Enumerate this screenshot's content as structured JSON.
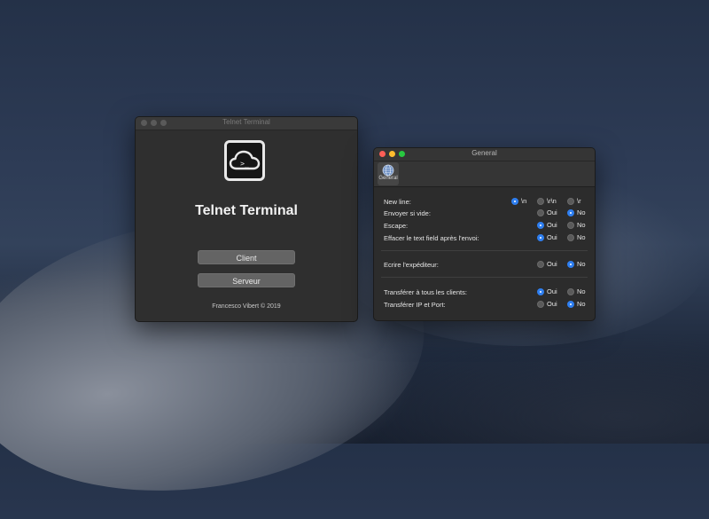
{
  "main_window": {
    "title": "Telnet Terminal",
    "app_name": "Telnet Terminal",
    "icon_glyph": ">_",
    "client_label": "Client",
    "server_label": "Serveur",
    "copyright": "Francesco Vibert © 2019"
  },
  "prefs_window": {
    "title": "General",
    "tab_label": "General",
    "rows": [
      {
        "label": "New line:",
        "options": [
          "\\n",
          "\\r\\n",
          "\\r"
        ],
        "selected": 0
      },
      {
        "label": "Envoyer si vide:",
        "options": [
          "Oui",
          "No"
        ],
        "selected": 1
      },
      {
        "label": "Escape:",
        "options": [
          "Oui",
          "No"
        ],
        "selected": 0
      },
      {
        "label": "Effacer le text field après l'envoi:",
        "options": [
          "Oui",
          "No"
        ],
        "selected": 0
      },
      {
        "label": "Ecrire l'expéditeur:",
        "options": [
          "Oui",
          "No"
        ],
        "selected": 1
      },
      {
        "label": "Transférer à tous les clients:",
        "options": [
          "Oui",
          "No"
        ],
        "selected": 0
      },
      {
        "label": "Transférer IP et Port:",
        "options": [
          "Oui",
          "No"
        ],
        "selected": 1
      }
    ]
  },
  "colors": {
    "accent": "#2f7ff0",
    "close": "#ff5f57",
    "minimize": "#febc2e",
    "zoom": "#28c840"
  }
}
